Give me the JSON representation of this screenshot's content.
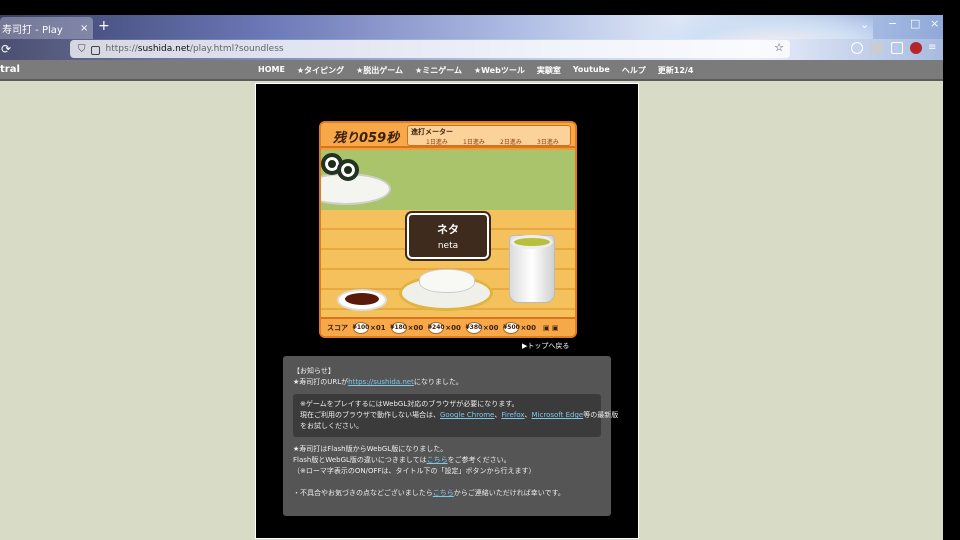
{
  "browser": {
    "tab_title": "寿司打 - Play",
    "tab_close": "×",
    "new_tab": "+",
    "list_tabs": "⌄",
    "minimize": "−",
    "maximize": "□",
    "close": "×",
    "url_prefix": "https://",
    "url_domain": "sushida.net",
    "url_path": "/play.html?soundless"
  },
  "site_nav": {
    "logo": "tral",
    "items": [
      "HOME",
      "★タイピング",
      "★脱出ゲーム",
      "★ミニゲーム",
      "★Webツール",
      "実験室",
      "Youtube",
      "ヘルプ",
      "更新12/4"
    ]
  },
  "game": {
    "timer": "残り059秒",
    "meter_label": "進打メーター",
    "meter_marks": [
      "1日進み",
      "1日進み",
      "2日進み",
      "3日進み"
    ],
    "neta_jp": "ネタ",
    "neta_roma": "neta",
    "score_label": "スコア",
    "prices": [
      {
        "price": "¥100",
        "count": "×01"
      },
      {
        "price": "¥180",
        "count": "×00"
      },
      {
        "price": "¥240",
        "count": "×00"
      },
      {
        "price": "¥380",
        "count": "×00"
      },
      {
        "price": "¥500",
        "count": "×00"
      }
    ],
    "score_icons": "▣ ▣"
  },
  "back_link": "▶トップへ戻る",
  "notice": {
    "heading": "【お知らせ】",
    "url_line_prefix": "★寿司打のURLが",
    "url_link": "https://sushida.net",
    "url_line_suffix": "になりました。",
    "box_line1": "※ゲームをプレイするにはWebGL対応のブラウザが必要になります。",
    "box_line2_prefix": "現在ご利用のブラウザで動作しない場合は、",
    "browser_chrome": "Google Chrome",
    "sep1": "、",
    "browser_firefox": "Firefox",
    "sep2": "、",
    "browser_edge": "Microsoft Edge",
    "box_line2_suffix": "等の最新版",
    "box_line3": "をお試しください。",
    "flash_line1": "★寿司打はFlash版からWebGL版になりました。",
    "flash_line2_prefix": "Flash版とWebGL版の違いにつきましては",
    "flash_link": "こちら",
    "flash_line2_suffix": "をご参考ください。",
    "flash_line3": "（※ローマ字表示のON/OFFは、タイトル下の「設定」ボタンから行えます）",
    "contact_prefix": "・不具合やお気づきの点などございましたら",
    "contact_link": "こちら",
    "contact_suffix": "からご連絡いただければ幸いです。"
  }
}
